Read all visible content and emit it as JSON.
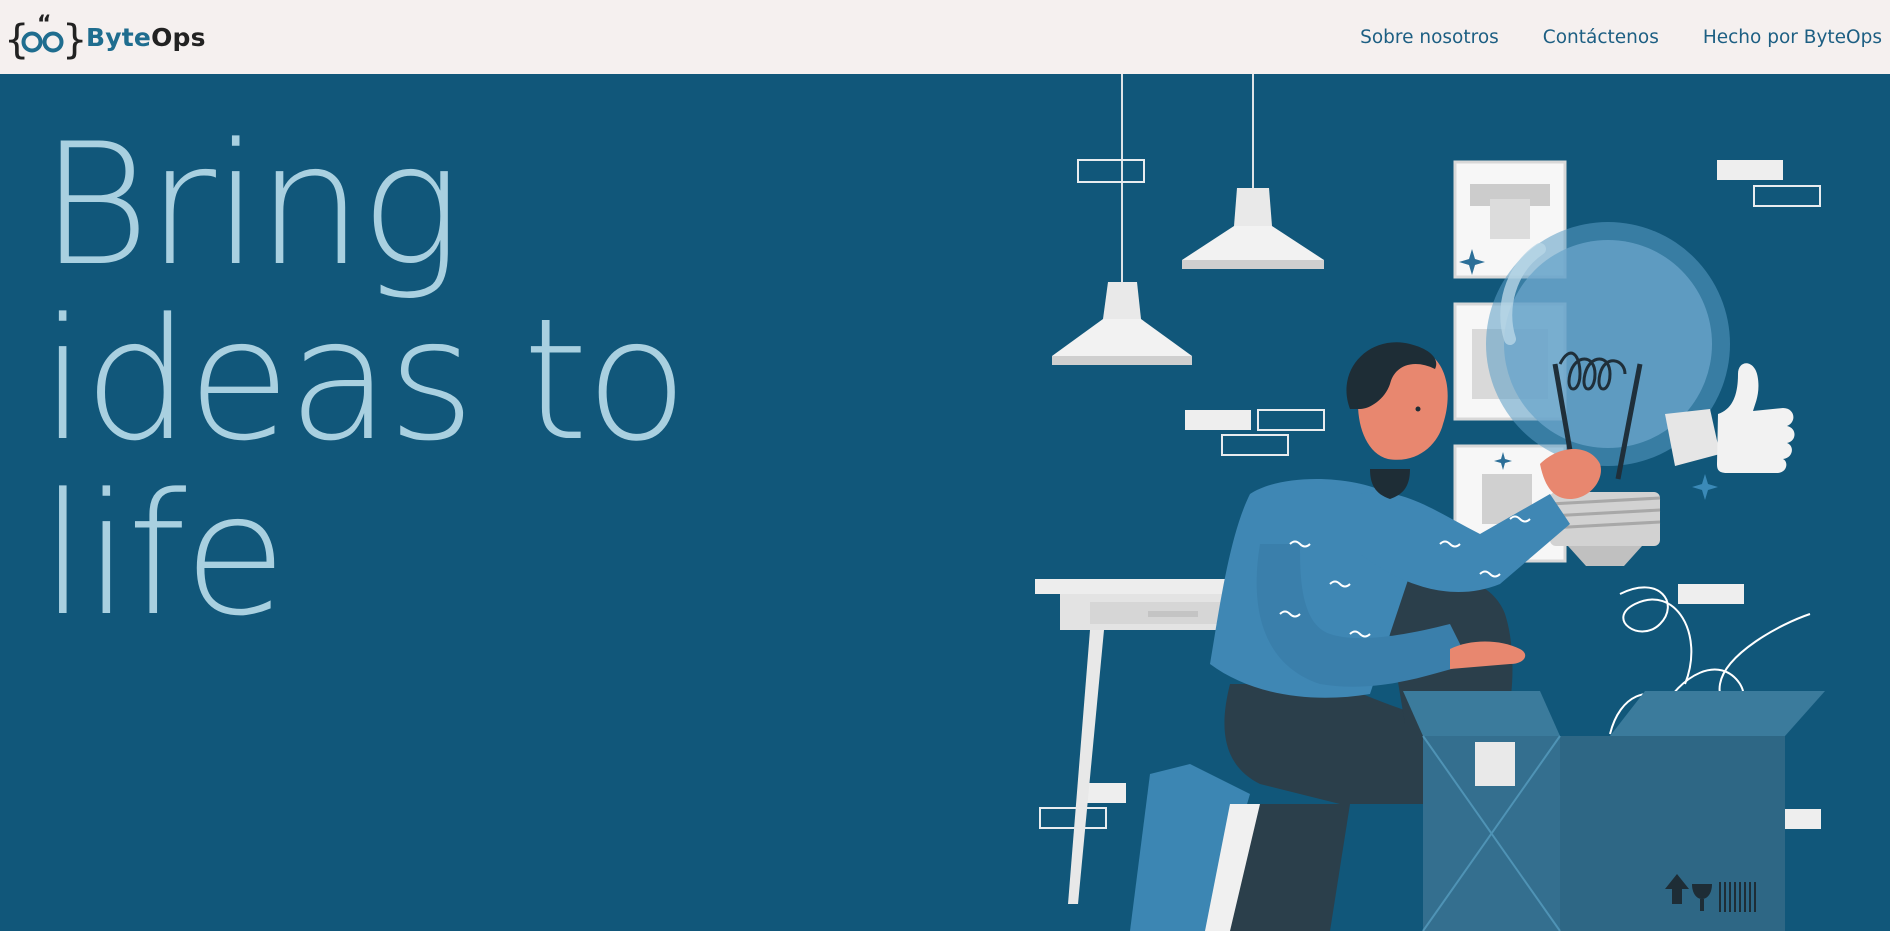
{
  "brand": {
    "logo_icon": "curly-braces-with-eyes-logo",
    "name_part1": "Byte",
    "name_part2": "Ops"
  },
  "nav": {
    "items": [
      {
        "label": "Sobre nosotros"
      },
      {
        "label": "Contáctenos"
      },
      {
        "label": "Hecho por ByteOps"
      }
    ]
  },
  "hero": {
    "headline": "Bring ideas to life",
    "illustration": "person-holding-lightbulb-illustration"
  },
  "colors": {
    "nav_background": "#f5f0ef",
    "hero_background": "#11577a",
    "headline": "#a9d0e0",
    "brand_accent": "#1f6d8f",
    "nav_link": "#1d5f83"
  }
}
